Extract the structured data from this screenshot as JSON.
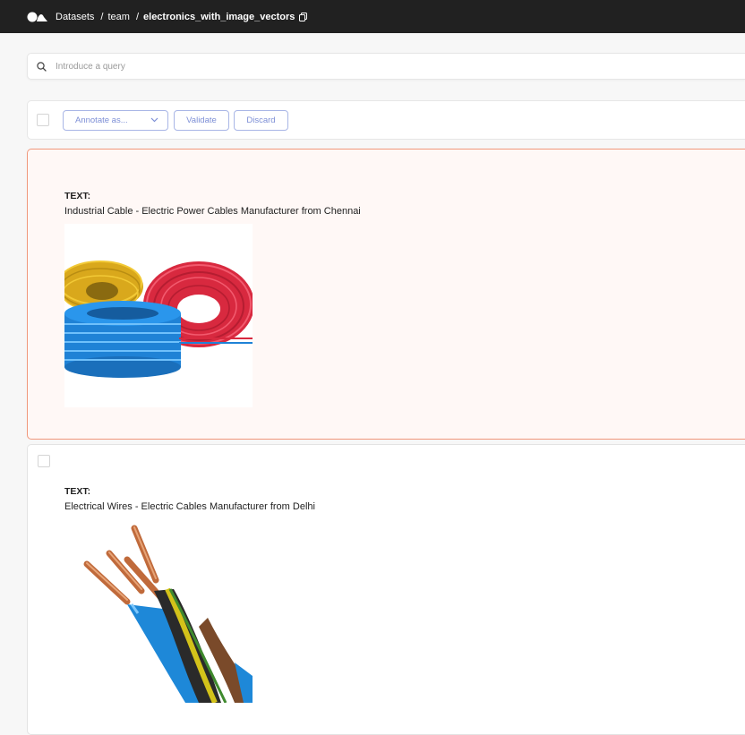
{
  "breadcrumb": {
    "items": [
      "Datasets",
      "team",
      "electronics_with_image_vectors"
    ],
    "separator": "/"
  },
  "search": {
    "placeholder": "Introduce a query",
    "value": ""
  },
  "toolbar": {
    "annotate_label": "Annotate as...",
    "validate_label": "Validate",
    "discard_label": "Discard"
  },
  "records": [
    {
      "field_label": "TEXT:",
      "text": "Industrial Cable - Electric Power Cables Manufacturer from Chennai",
      "image": "coiled-cables-image",
      "selected": true
    },
    {
      "field_label": "TEXT:",
      "text": "Electrical Wires - Electric Cables Manufacturer from Delhi",
      "image": "stripped-wires-image",
      "selected": false
    }
  ],
  "colors": {
    "topbar": "#212121",
    "accent_border": "#f0977b",
    "selected_bg": "#fff8f6",
    "button": "#7d8fd6"
  }
}
